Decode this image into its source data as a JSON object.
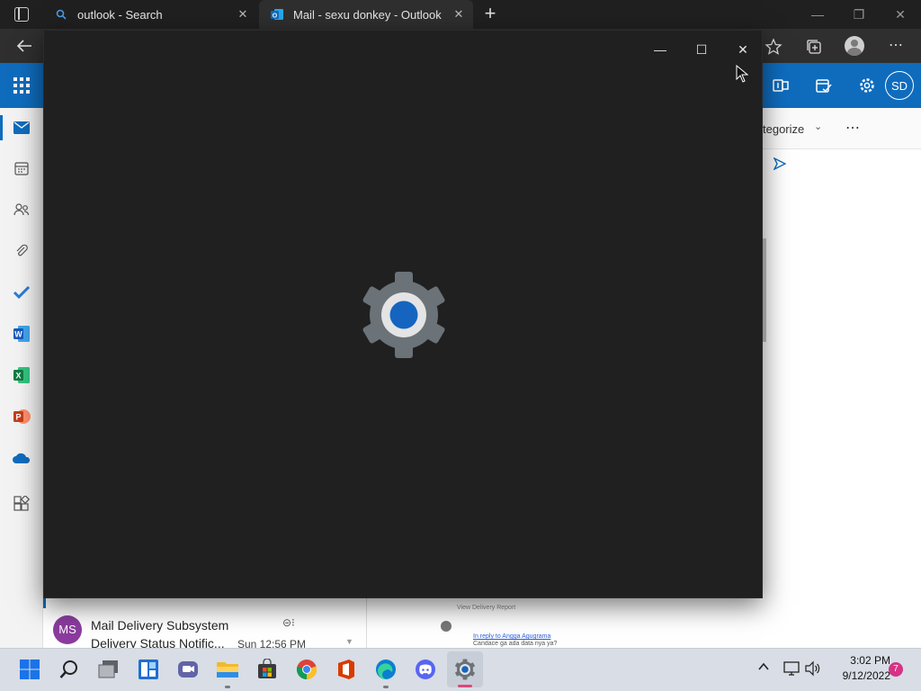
{
  "browser": {
    "tabs": [
      {
        "title": "outlook - Search"
      },
      {
        "title": "Mail - sexu donkey - Outlook"
      }
    ]
  },
  "outlook": {
    "avatar_initials": "SD",
    "categorize_label": "tegorize",
    "more_label": "⋯",
    "mail_item": {
      "sender_initials": "MS",
      "sender": "Mail Delivery Subsystem",
      "subject": "Delivery Status Notific...",
      "time": "Sun 12:56 PM"
    },
    "reading_pane": {
      "view_link": "View Delivery Report",
      "reply_link": "In reply to Angga Agugrama",
      "preview_text": "Candace ga ada data nya ya?"
    }
  },
  "taskbar": {
    "time": "3:02 PM",
    "date": "9/12/2022",
    "notification_count": "7"
  },
  "colors": {
    "outlook_blue": "#0f6cbd",
    "splash_bg": "#202020",
    "gear_gray": "#6b7278",
    "gear_blue": "#1565c0",
    "taskbar_bg": "#d8dde6"
  }
}
